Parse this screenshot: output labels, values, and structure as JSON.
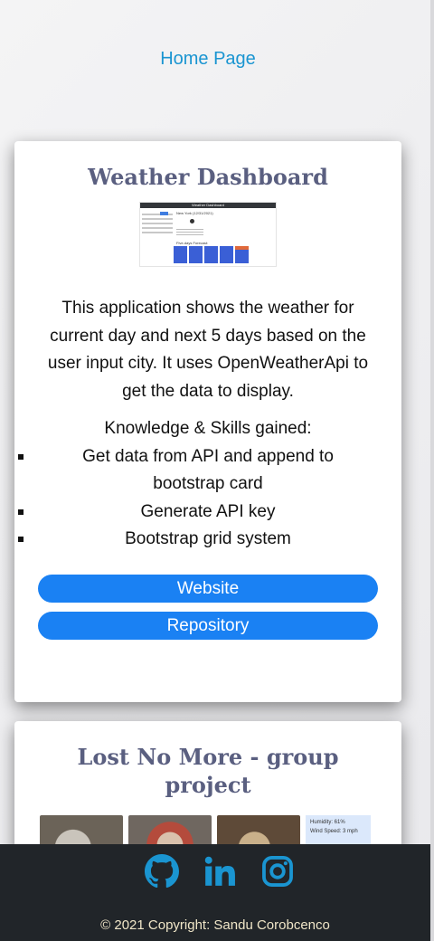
{
  "nav": {
    "home_label": "Home Page"
  },
  "projects": [
    {
      "title": "Weather Dashboard",
      "thumbnail": {
        "header": "Weather Dashboard",
        "city": "New York (12/31/2021)",
        "forecast_label": "Five-days Forecast:"
      },
      "description": "This application shows the weather for current day and next 5 days based on the user input city. It uses OpenWeatherApi to get the data to display.",
      "skills_heading": "Knowledge & Skills gained:",
      "skills": [
        "Get data from API and append to bootstrap card",
        "Generate API key",
        "Bootstrap grid system"
      ],
      "website_label": "Website",
      "repository_label": "Repository"
    },
    {
      "title": "Lost No More - group project",
      "preview_weather": {
        "humidity": "Humidity: 61%",
        "wind": "Wind Speed: 3 mph"
      }
    }
  ],
  "footer": {
    "icons": [
      "github-icon",
      "linkedin-icon",
      "instagram-icon"
    ],
    "icon_color": "#1a95d1",
    "copyright": "© 2021 Copyright: Sandu Corobcenco"
  },
  "colors": {
    "link": "#1a95d1",
    "title": "#5a5f80",
    "button": "#1a81f3",
    "footer_bg": "#212529"
  }
}
